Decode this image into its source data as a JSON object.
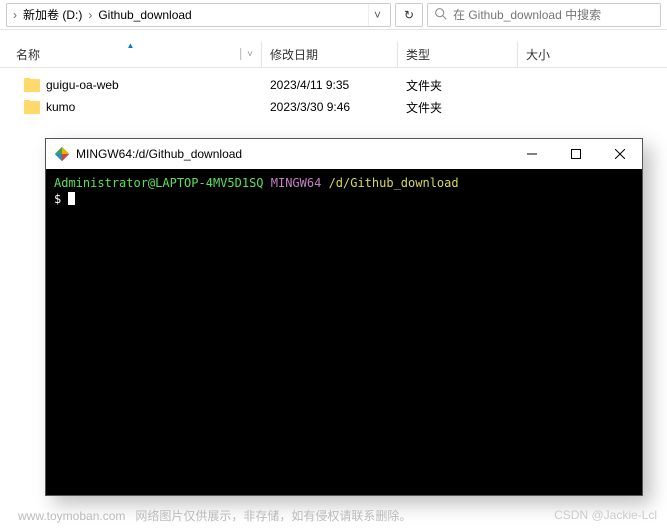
{
  "breadcrumb": {
    "item1": "新加卷 (D:)",
    "item2": "Github_download"
  },
  "search": {
    "placeholder": "在 Github_download 中搜索"
  },
  "columns": {
    "name": "名称",
    "date": "修改日期",
    "type": "类型",
    "size": "大小"
  },
  "rows": [
    {
      "name": "guigu-oa-web",
      "date": "2023/4/11 9:35",
      "type": "文件夹",
      "size": ""
    },
    {
      "name": "kumo",
      "date": "2023/3/30 9:46",
      "type": "文件夹",
      "size": ""
    }
  ],
  "terminal": {
    "title": "MINGW64:/d/Github_download",
    "user": "Administrator@LAPTOP-4MV5D1SQ",
    "sys": "MINGW64",
    "path": "/d/Github_download",
    "prompt": "$ "
  },
  "watermark": {
    "site": "www.toymoban.com",
    "notice": "网络图片仅供展示，非存储，如有侵权请联系删除。",
    "csdn": "CSDN @Jackie-Lcl"
  }
}
